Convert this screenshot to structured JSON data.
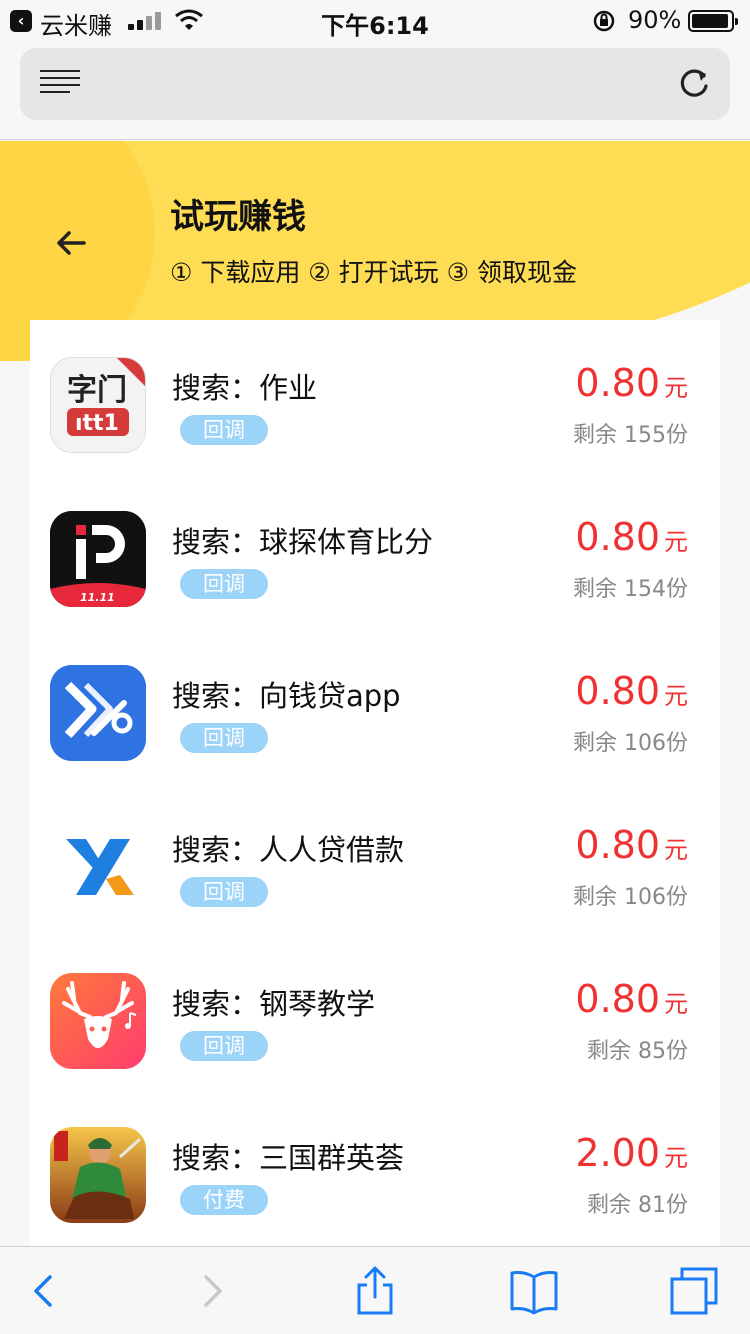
{
  "status_bar": {
    "back_app": "云米赚",
    "time": "下午6:14",
    "battery": "90%"
  },
  "colors": {
    "accent_yellow": "#fedd55",
    "price_red": "#f03131",
    "tag_blue": "#9cd3f8",
    "ios_blue": "#1a7cf5"
  },
  "header": {
    "title": "试玩赚钱",
    "steps": "① 下载应用 ② 打开试玩 ③ 领取现金"
  },
  "tasks": [
    {
      "title": "搜索：作业",
      "tag": "回调",
      "price": "0.80",
      "unit": "元",
      "remaining": "剩余 155份",
      "icon": "homework-app-icon"
    },
    {
      "title": "搜索：球探体育比分",
      "tag": "回调",
      "price": "0.80",
      "unit": "元",
      "remaining": "剩余 154份",
      "icon": "sports-score-app-icon"
    },
    {
      "title": "搜索：向钱贷app",
      "tag": "回调",
      "price": "0.80",
      "unit": "元",
      "remaining": "剩余 106份",
      "icon": "loan-app-icon"
    },
    {
      "title": "搜索：人人贷借款",
      "tag": "回调",
      "price": "0.80",
      "unit": "元",
      "remaining": "剩余 106份",
      "icon": "renrendai-app-icon"
    },
    {
      "title": "搜索：钢琴教学",
      "tag": "回调",
      "price": "0.80",
      "unit": "元",
      "remaining": "剩余 85份",
      "icon": "piano-app-icon"
    },
    {
      "title": "搜索：三国群英荟",
      "tag": "付费",
      "price": "2.00",
      "unit": "元",
      "remaining": "剩余 81份",
      "icon": "three-kingdoms-game-icon"
    }
  ],
  "toolbar": {
    "items": [
      "back-icon",
      "forward-icon",
      "share-icon",
      "bookmarks-icon",
      "tabs-icon"
    ]
  }
}
